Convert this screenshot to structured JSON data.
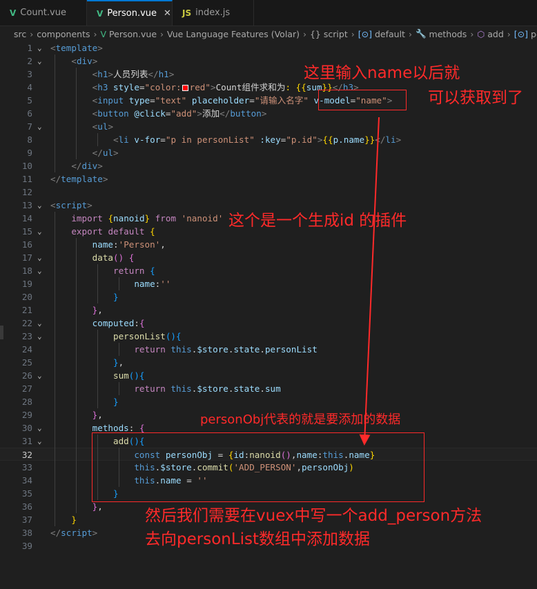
{
  "tabs": [
    {
      "label": "Count.vue",
      "icon": "vue-icon"
    },
    {
      "label": "Person.vue",
      "icon": "vue-icon",
      "active": true
    },
    {
      "label": "index.js",
      "icon": "js-icon"
    }
  ],
  "tab_js_glyph": "JS",
  "tab_close_glyph": "✕",
  "breadcrumb": [
    "src",
    "components",
    "Person.vue",
    "Vue Language Features (Volar)",
    "script",
    "default",
    "methods",
    "add",
    "personObj"
  ],
  "breadcrumb_icons": {
    "curly": "{}",
    "bracket": "[⊙]"
  },
  "code_lines": [
    {
      "n": "1",
      "fold": "⌄"
    },
    {
      "n": "2",
      "fold": "⌄"
    },
    {
      "n": "3"
    },
    {
      "n": "4"
    },
    {
      "n": "5"
    },
    {
      "n": "6"
    },
    {
      "n": "7",
      "fold": "⌄"
    },
    {
      "n": "8"
    },
    {
      "n": "9"
    },
    {
      "n": "10"
    },
    {
      "n": "11"
    },
    {
      "n": "12"
    },
    {
      "n": "13",
      "fold": "⌄"
    },
    {
      "n": "14"
    },
    {
      "n": "15",
      "fold": "⌄"
    },
    {
      "n": "16"
    },
    {
      "n": "17",
      "fold": "⌄"
    },
    {
      "n": "18",
      "fold": "⌄"
    },
    {
      "n": "19"
    },
    {
      "n": "20"
    },
    {
      "n": "21"
    },
    {
      "n": "22",
      "fold": "⌄"
    },
    {
      "n": "23",
      "fold": "⌄"
    },
    {
      "n": "24"
    },
    {
      "n": "25"
    },
    {
      "n": "26",
      "fold": "⌄"
    },
    {
      "n": "27"
    },
    {
      "n": "28"
    },
    {
      "n": "29"
    },
    {
      "n": "30",
      "fold": "⌄"
    },
    {
      "n": "31",
      "fold": "⌄"
    },
    {
      "n": "32",
      "current": true
    },
    {
      "n": "33"
    },
    {
      "n": "34"
    },
    {
      "n": "35"
    },
    {
      "n": "36"
    },
    {
      "n": "37"
    },
    {
      "n": "38"
    },
    {
      "n": "39"
    }
  ],
  "code": {
    "l1": [
      "<",
      "template",
      ">"
    ],
    "l2": [
      "<",
      "div",
      ">"
    ],
    "l3": [
      "<",
      "h1",
      ">",
      "人员列表",
      "</",
      "h1",
      ">"
    ],
    "l4": [
      "<",
      "h3",
      " ",
      "style",
      "=",
      "\"color:",
      "red",
      "\"",
      ">",
      "Count组件求和为",
      ":",
      " {{",
      "sum",
      "}}",
      "</",
      "h3",
      ">"
    ],
    "l5": [
      "<",
      "input",
      " ",
      "type",
      "=",
      "\"text\"",
      " ",
      "placeholder",
      "=",
      "\"请输入名字\"",
      " ",
      "v-model",
      "=",
      "\"name\"",
      ">"
    ],
    "l6": [
      "<",
      "button",
      " ",
      "@click",
      "=",
      "\"add\"",
      ">",
      "添加",
      "</",
      "button",
      ">"
    ],
    "l7": [
      "<",
      "ul",
      ">"
    ],
    "l8": [
      "<",
      "li",
      " ",
      "v-for",
      "=",
      "\"p in personList\"",
      " ",
      ":key",
      "=",
      "\"p.id\"",
      ">",
      "{{",
      "p.name",
      "}}",
      "</",
      "li",
      ">"
    ],
    "l9": [
      "</",
      "ul",
      ">"
    ],
    "l10": [
      "</",
      "div",
      ">"
    ],
    "l11": [
      "</",
      "template",
      ">"
    ],
    "l13": [
      "<",
      "script",
      ">"
    ],
    "l14": [
      "import",
      " ",
      "{",
      "nanoid",
      "}",
      " from ",
      "'nanoid'"
    ],
    "l15": [
      "export",
      " ",
      "default",
      " ",
      "{"
    ],
    "l16": [
      "name",
      ":",
      "'Person'",
      ","
    ],
    "l17": [
      "data",
      "()",
      " ",
      "{"
    ],
    "l18": [
      "return",
      " ",
      "{"
    ],
    "l19": [
      "name",
      ":",
      "''"
    ],
    "l20": [
      "}"
    ],
    "l21": [
      "}",
      ","
    ],
    "l22": [
      "computed",
      ":",
      "{"
    ],
    "l23": [
      "personList",
      "()",
      "{"
    ],
    "l24": [
      "return",
      " ",
      "this",
      ".",
      "$store",
      ".",
      "state",
      ".",
      "personList"
    ],
    "l25": [
      "}",
      ","
    ],
    "l26": [
      "sum",
      "()",
      "{"
    ],
    "l27": [
      "return",
      " ",
      "this",
      ".",
      "$store",
      ".",
      "state",
      ".",
      "sum"
    ],
    "l28": [
      "}"
    ],
    "l29": [
      "}",
      ","
    ],
    "l30": [
      "methods",
      ":",
      " ",
      "{"
    ],
    "l31": [
      "add",
      "()",
      "{"
    ],
    "l32": [
      "const",
      " ",
      "personObj",
      " = ",
      "{",
      "id",
      ":",
      "nanoid",
      "()",
      ",",
      "name",
      ":",
      "this",
      ".",
      "name",
      "}"
    ],
    "l33": [
      "this",
      ".",
      "$store",
      ".",
      "commit",
      "(",
      "'ADD_PERSON'",
      ",",
      "personObj",
      ")"
    ],
    "l34": [
      "this",
      ".",
      "name",
      " = ",
      "''"
    ],
    "l35": [
      "}"
    ],
    "l36": [
      "}",
      ","
    ],
    "l37": [
      "}"
    ],
    "l38": [
      "</",
      "script",
      ">"
    ]
  },
  "annotations": {
    "a1_line1": "这里输入name以后就",
    "a1_line2": "可以获取到了",
    "a2": "这个是一个生成id 的插件",
    "a3": "personObj代表的就是要添加的数据",
    "a4_line1": "然后我们需要在vuex中写一个add_person方法",
    "a4_line2": "去向personList数组中添加数据"
  },
  "colors": {
    "annotation": "#ff2a2a",
    "accent": "#0078d4"
  }
}
